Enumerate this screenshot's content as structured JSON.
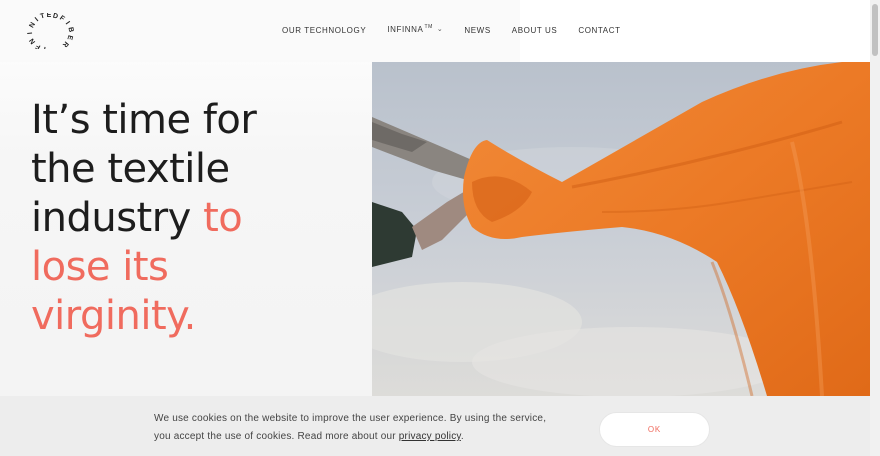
{
  "brand": {
    "logo_text": "INFINITEDFIBER",
    "accent_color": "#f06b5e"
  },
  "nav": {
    "items": [
      {
        "label": "OUR TECHNOLOGY"
      },
      {
        "label": "INFINNA",
        "sup": "TM",
        "has_dropdown": true
      },
      {
        "label": "NEWS"
      },
      {
        "label": "ABOUT US"
      },
      {
        "label": "CONTACT"
      }
    ]
  },
  "hero": {
    "line1": "It’s time for",
    "line2": "the textile",
    "line3_dark": "industry ",
    "line3_accent": "to",
    "line4": "lose its",
    "line5": "virginity.",
    "image_icon": "orange-fabric-image"
  },
  "cookie": {
    "text_part1": "We use cookies on the website to improve the user experience. By using the service, you accept the use of cookies. Read more about our ",
    "link_label": "privacy policy",
    "text_part2": ".",
    "ok_label": "OK"
  }
}
